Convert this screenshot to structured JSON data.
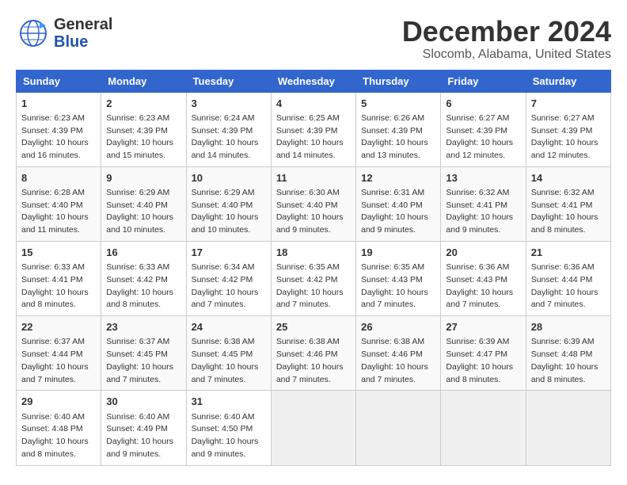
{
  "logo": {
    "line1": "General",
    "line2": "Blue"
  },
  "title": "December 2024",
  "location": "Slocomb, Alabama, United States",
  "headers": [
    "Sunday",
    "Monday",
    "Tuesday",
    "Wednesday",
    "Thursday",
    "Friday",
    "Saturday"
  ],
  "weeks": [
    [
      {
        "day": "1",
        "info": "Sunrise: 6:23 AM\nSunset: 4:39 PM\nDaylight: 10 hours\nand 16 minutes."
      },
      {
        "day": "2",
        "info": "Sunrise: 6:23 AM\nSunset: 4:39 PM\nDaylight: 10 hours\nand 15 minutes."
      },
      {
        "day": "3",
        "info": "Sunrise: 6:24 AM\nSunset: 4:39 PM\nDaylight: 10 hours\nand 14 minutes."
      },
      {
        "day": "4",
        "info": "Sunrise: 6:25 AM\nSunset: 4:39 PM\nDaylight: 10 hours\nand 14 minutes."
      },
      {
        "day": "5",
        "info": "Sunrise: 6:26 AM\nSunset: 4:39 PM\nDaylight: 10 hours\nand 13 minutes."
      },
      {
        "day": "6",
        "info": "Sunrise: 6:27 AM\nSunset: 4:39 PM\nDaylight: 10 hours\nand 12 minutes."
      },
      {
        "day": "7",
        "info": "Sunrise: 6:27 AM\nSunset: 4:39 PM\nDaylight: 10 hours\nand 12 minutes."
      }
    ],
    [
      {
        "day": "8",
        "info": "Sunrise: 6:28 AM\nSunset: 4:40 PM\nDaylight: 10 hours\nand 11 minutes."
      },
      {
        "day": "9",
        "info": "Sunrise: 6:29 AM\nSunset: 4:40 PM\nDaylight: 10 hours\nand 10 minutes."
      },
      {
        "day": "10",
        "info": "Sunrise: 6:29 AM\nSunset: 4:40 PM\nDaylight: 10 hours\nand 10 minutes."
      },
      {
        "day": "11",
        "info": "Sunrise: 6:30 AM\nSunset: 4:40 PM\nDaylight: 10 hours\nand 9 minutes."
      },
      {
        "day": "12",
        "info": "Sunrise: 6:31 AM\nSunset: 4:40 PM\nDaylight: 10 hours\nand 9 minutes."
      },
      {
        "day": "13",
        "info": "Sunrise: 6:32 AM\nSunset: 4:41 PM\nDaylight: 10 hours\nand 9 minutes."
      },
      {
        "day": "14",
        "info": "Sunrise: 6:32 AM\nSunset: 4:41 PM\nDaylight: 10 hours\nand 8 minutes."
      }
    ],
    [
      {
        "day": "15",
        "info": "Sunrise: 6:33 AM\nSunset: 4:41 PM\nDaylight: 10 hours\nand 8 minutes."
      },
      {
        "day": "16",
        "info": "Sunrise: 6:33 AM\nSunset: 4:42 PM\nDaylight: 10 hours\nand 8 minutes."
      },
      {
        "day": "17",
        "info": "Sunrise: 6:34 AM\nSunset: 4:42 PM\nDaylight: 10 hours\nand 7 minutes."
      },
      {
        "day": "18",
        "info": "Sunrise: 6:35 AM\nSunset: 4:42 PM\nDaylight: 10 hours\nand 7 minutes."
      },
      {
        "day": "19",
        "info": "Sunrise: 6:35 AM\nSunset: 4:43 PM\nDaylight: 10 hours\nand 7 minutes."
      },
      {
        "day": "20",
        "info": "Sunrise: 6:36 AM\nSunset: 4:43 PM\nDaylight: 10 hours\nand 7 minutes."
      },
      {
        "day": "21",
        "info": "Sunrise: 6:36 AM\nSunset: 4:44 PM\nDaylight: 10 hours\nand 7 minutes."
      }
    ],
    [
      {
        "day": "22",
        "info": "Sunrise: 6:37 AM\nSunset: 4:44 PM\nDaylight: 10 hours\nand 7 minutes."
      },
      {
        "day": "23",
        "info": "Sunrise: 6:37 AM\nSunset: 4:45 PM\nDaylight: 10 hours\nand 7 minutes."
      },
      {
        "day": "24",
        "info": "Sunrise: 6:38 AM\nSunset: 4:45 PM\nDaylight: 10 hours\nand 7 minutes."
      },
      {
        "day": "25",
        "info": "Sunrise: 6:38 AM\nSunset: 4:46 PM\nDaylight: 10 hours\nand 7 minutes."
      },
      {
        "day": "26",
        "info": "Sunrise: 6:38 AM\nSunset: 4:46 PM\nDaylight: 10 hours\nand 7 minutes."
      },
      {
        "day": "27",
        "info": "Sunrise: 6:39 AM\nSunset: 4:47 PM\nDaylight: 10 hours\nand 8 minutes."
      },
      {
        "day": "28",
        "info": "Sunrise: 6:39 AM\nSunset: 4:48 PM\nDaylight: 10 hours\nand 8 minutes."
      }
    ],
    [
      {
        "day": "29",
        "info": "Sunrise: 6:40 AM\nSunset: 4:48 PM\nDaylight: 10 hours\nand 8 minutes."
      },
      {
        "day": "30",
        "info": "Sunrise: 6:40 AM\nSunset: 4:49 PM\nDaylight: 10 hours\nand 9 minutes."
      },
      {
        "day": "31",
        "info": "Sunrise: 6:40 AM\nSunset: 4:50 PM\nDaylight: 10 hours\nand 9 minutes."
      },
      null,
      null,
      null,
      null
    ]
  ]
}
